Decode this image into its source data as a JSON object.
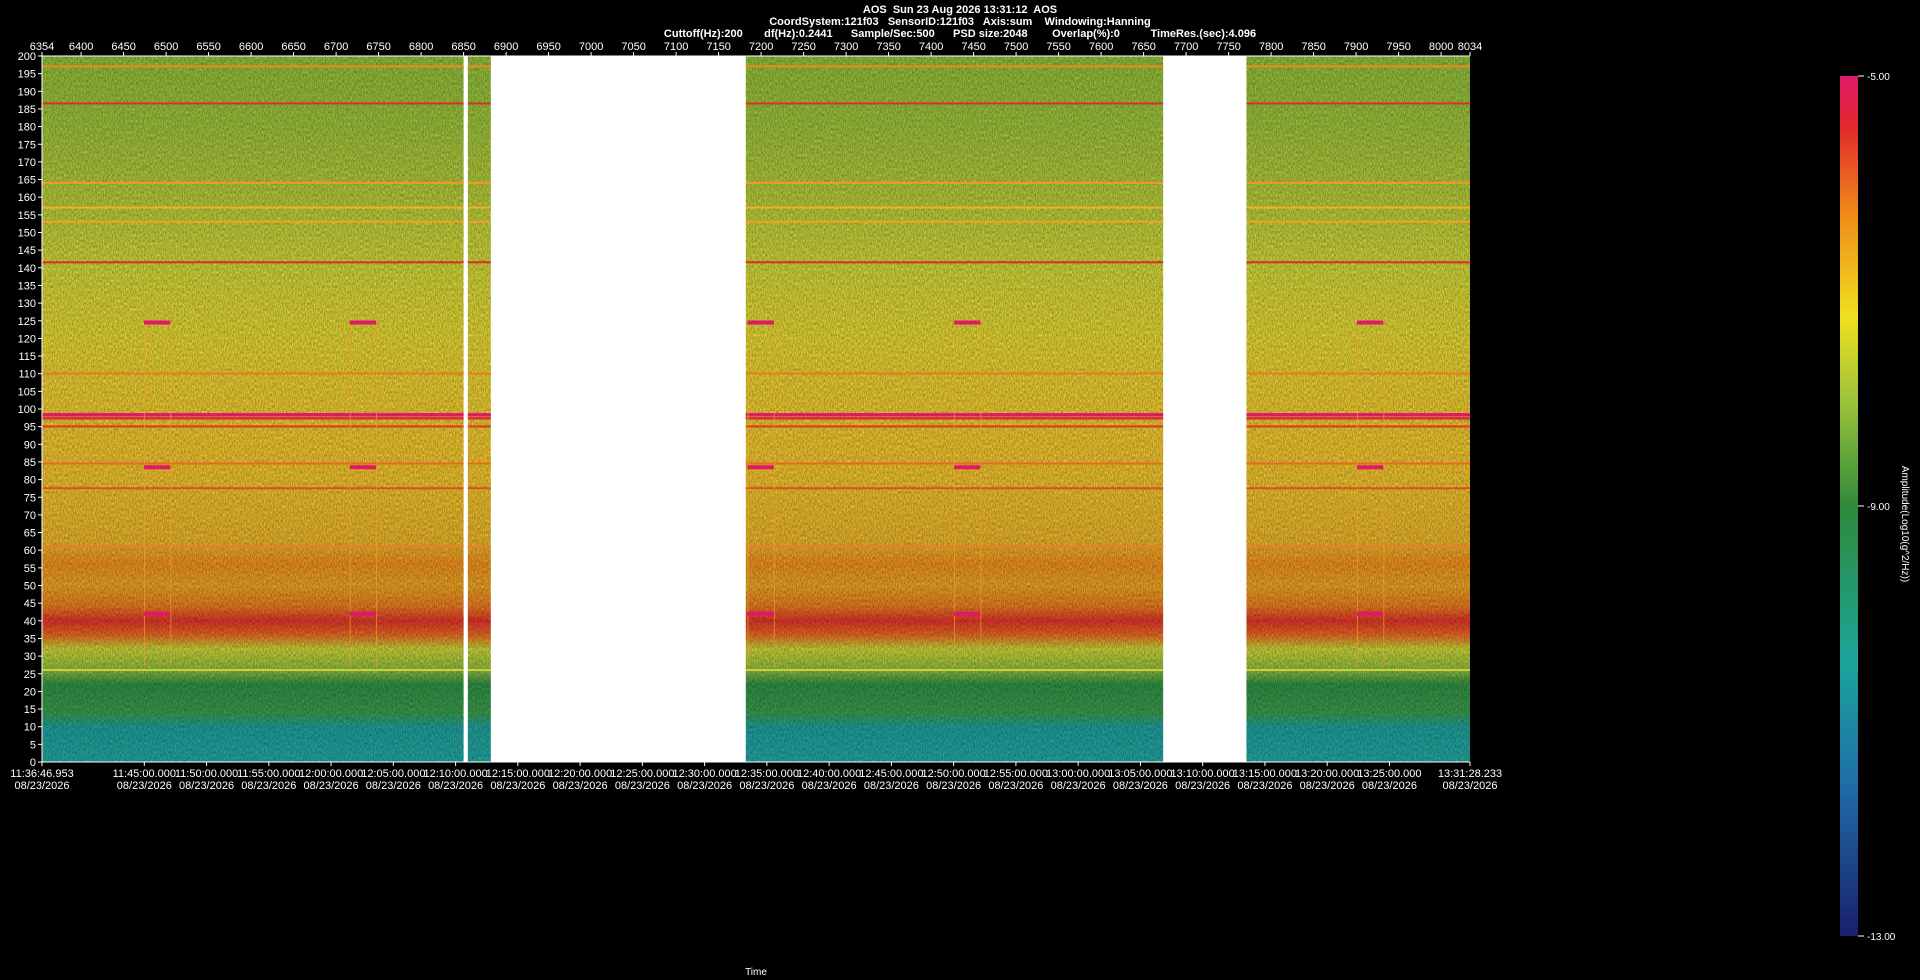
{
  "header": {
    "title": "AOS  Sun 23 Aug 2026 13:31:12  AOS",
    "line2": "CoordSystem:121f03   SensorID:121f03   Axis:sum    Windowing:Hanning",
    "line3": "Cuttoff(Hz):200       df(Hz):0.2441      Sample/Sec:500      PSD size:2048        Overlap(%):0          TimeRes.(sec):4.096"
  },
  "chart_data": {
    "type": "heatmap",
    "subtype": "spectrogram",
    "xlabel": "Time",
    "ylabel": "",
    "colorbar_label": "Amplitude(Log10(g^2/Hz))",
    "colorbar_ticks": [
      "-5.00",
      "-9.00",
      "-13.00"
    ],
    "colorbar_range": [
      -13,
      -5
    ],
    "ylim": [
      0,
      200
    ],
    "y_ticks": [
      0,
      5,
      10,
      15,
      20,
      25,
      30,
      35,
      40,
      45,
      50,
      55,
      60,
      65,
      70,
      75,
      80,
      85,
      90,
      95,
      100,
      105,
      110,
      115,
      120,
      125,
      130,
      135,
      140,
      145,
      150,
      155,
      160,
      165,
      170,
      175,
      180,
      185,
      190,
      195,
      200
    ],
    "index_range": [
      6354,
      8034
    ],
    "index_ticks": [
      6354,
      6400,
      6450,
      6500,
      6550,
      6600,
      6650,
      6700,
      6750,
      6800,
      6850,
      6900,
      6950,
      7000,
      7050,
      7100,
      7150,
      7200,
      7250,
      7300,
      7350,
      7400,
      7450,
      7500,
      7550,
      7600,
      7650,
      7700,
      7750,
      7800,
      7850,
      7900,
      7950,
      8000,
      8034
    ],
    "time_ticks": [
      {
        "time": "11:36:46.953",
        "date": "08/23/2026"
      },
      {
        "time": "11:45:00.000",
        "date": "08/23/2026"
      },
      {
        "time": "11:50:00.000",
        "date": "08/23/2026"
      },
      {
        "time": "11:55:00.000",
        "date": "08/23/2026"
      },
      {
        "time": "12:00:00.000",
        "date": "08/23/2026"
      },
      {
        "time": "12:05:00.000",
        "date": "08/23/2026"
      },
      {
        "time": "12:10:00.000",
        "date": "08/23/2026"
      },
      {
        "time": "12:15:00.000",
        "date": "08/23/2026"
      },
      {
        "time": "12:20:00.000",
        "date": "08/23/2026"
      },
      {
        "time": "12:25:00.000",
        "date": "08/23/2026"
      },
      {
        "time": "12:30:00.000",
        "date": "08/23/2026"
      },
      {
        "time": "12:35:00.000",
        "date": "08/23/2026"
      },
      {
        "time": "12:40:00.000",
        "date": "08/23/2026"
      },
      {
        "time": "12:45:00.000",
        "date": "08/23/2026"
      },
      {
        "time": "12:50:00.000",
        "date": "08/23/2026"
      },
      {
        "time": "12:55:00.000",
        "date": "08/23/2026"
      },
      {
        "time": "13:00:00.000",
        "date": "08/23/2026"
      },
      {
        "time": "13:05:00.000",
        "date": "08/23/2026"
      },
      {
        "time": "13:10:00.000",
        "date": "08/23/2026"
      },
      {
        "time": "13:15:00.000",
        "date": "08/23/2026"
      },
      {
        "time": "13:20:00.000",
        "date": "08/23/2026"
      },
      {
        "time": "13:25:00.000",
        "date": "08/23/2026"
      },
      {
        "time": "13:31:28.233",
        "date": "08/23/2026"
      }
    ],
    "data_gaps_index": [
      [
        6850,
        6855
      ],
      [
        6882,
        7182
      ],
      [
        7673,
        7771
      ]
    ],
    "intensity_bands": [
      {
        "freq_from": 0,
        "freq_to": 12,
        "level": "cyan"
      },
      {
        "freq_from": 12,
        "freq_to": 25,
        "level": "green"
      },
      {
        "freq_from": 25,
        "freq_to": 35,
        "level": "yellow-green"
      },
      {
        "freq_from": 35,
        "freq_to": 45,
        "level": "red"
      },
      {
        "freq_from": 45,
        "freq_to": 62,
        "level": "orange"
      },
      {
        "freq_from": 62,
        "freq_to": 100,
        "level": "yellow-orange"
      },
      {
        "freq_from": 100,
        "freq_to": 140,
        "level": "yellow"
      },
      {
        "freq_from": 140,
        "freq_to": 200,
        "level": "yellow-green"
      }
    ],
    "spectral_lines_hz": [
      197,
      186.5,
      164,
      157,
      153,
      141.5,
      110,
      98.5,
      97.5,
      95,
      84.5,
      77.5,
      61,
      26
    ],
    "events": [
      {
        "index_from": 6474,
        "index_to": 6505,
        "peaks_hz": [
          124.5,
          83.5,
          42
        ]
      },
      {
        "index_from": 6716,
        "index_to": 6747,
        "peaks_hz": [
          124.5,
          83.5,
          42
        ]
      },
      {
        "index_from": 7184,
        "index_to": 7215,
        "peaks_hz": [
          124.5,
          83.5,
          42
        ]
      },
      {
        "index_from": 7427,
        "index_to": 7458,
        "peaks_hz": [
          124.5,
          83.5,
          42
        ]
      },
      {
        "index_from": 7901,
        "index_to": 7932,
        "peaks_hz": [
          124.5,
          83.5,
          42
        ]
      }
    ]
  }
}
